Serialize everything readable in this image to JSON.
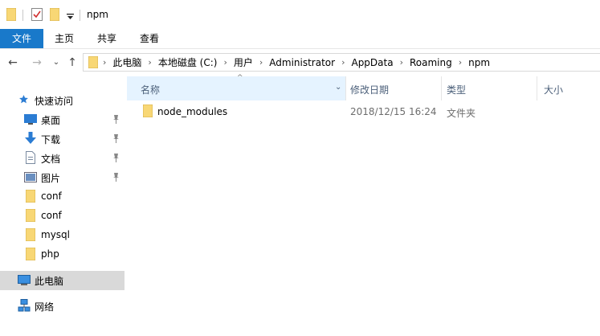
{
  "window": {
    "title": "npm"
  },
  "ribbon": {
    "tabs": [
      "文件",
      "主页",
      "共享",
      "查看"
    ]
  },
  "address": {
    "crumbs": [
      "此电脑",
      "本地磁盘 (C:)",
      "用户",
      "Administrator",
      "AppData",
      "Roaming",
      "npm"
    ]
  },
  "sidebar": {
    "quick_access": "快速访问",
    "items": [
      {
        "label": "桌面",
        "icon": "desktop-icon",
        "pinned": true
      },
      {
        "label": "下载",
        "icon": "download-icon",
        "pinned": true
      },
      {
        "label": "文档",
        "icon": "document-icon",
        "pinned": true
      },
      {
        "label": "图片",
        "icon": "picture-icon",
        "pinned": true
      },
      {
        "label": "conf",
        "icon": "folder-icon",
        "pinned": false
      },
      {
        "label": "conf",
        "icon": "folder-icon",
        "pinned": false
      },
      {
        "label": "mysql",
        "icon": "folder-icon",
        "pinned": false
      },
      {
        "label": "php",
        "icon": "folder-icon",
        "pinned": false
      }
    ],
    "this_pc": "此电脑",
    "network": "网络"
  },
  "columns": {
    "name": "名称",
    "modified": "修改日期",
    "type": "类型",
    "size": "大小"
  },
  "files": [
    {
      "name": "node_modules",
      "modified": "2018/12/15 16:24",
      "type": "文件夹",
      "size": ""
    }
  ],
  "colors": {
    "accent": "#1979ca",
    "folder": "#f8d775",
    "header_hover": "#e5f3ff",
    "selected": "#d9d9d9"
  }
}
